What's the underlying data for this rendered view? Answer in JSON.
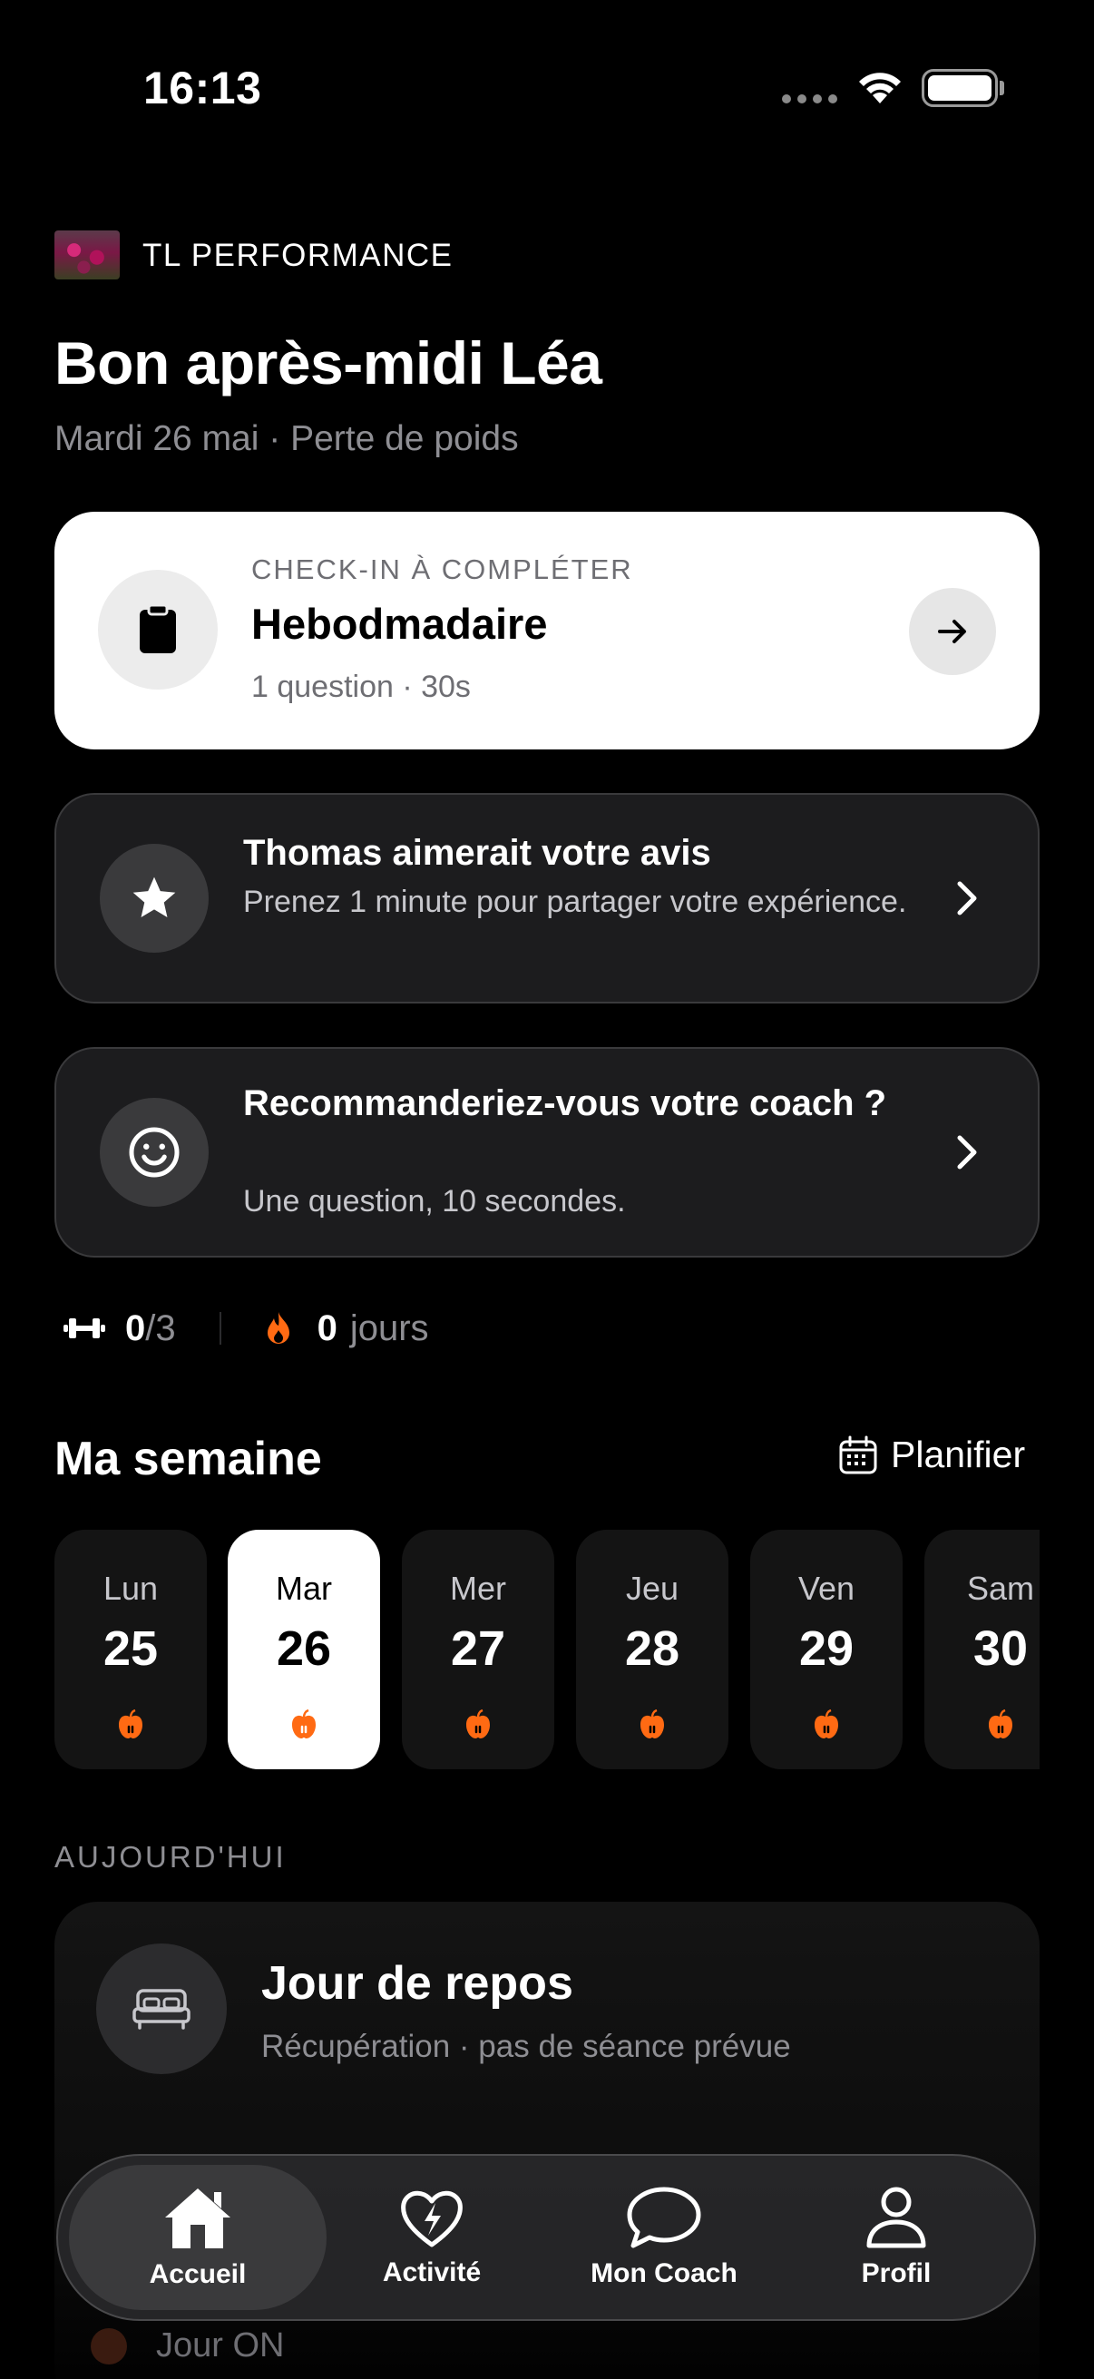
{
  "status_bar": {
    "time": "16:13"
  },
  "brand": {
    "name": "TL PERFORMANCE"
  },
  "header": {
    "greeting": "Bon après-midi Léa",
    "subline": "Mardi 26 mai · Perte de poids"
  },
  "checkin": {
    "overline": "CHECK-IN À COMPLÉTER",
    "title": "Hebodmadaire",
    "meta": "1 question · 30s"
  },
  "feedback_cards": [
    {
      "title": "Thomas aimerait votre avis",
      "description": "Prenez 1 minute pour partager votre expérience.",
      "icon": "star-icon"
    },
    {
      "title": "Recommanderiez-vous votre coach ?",
      "description": "Une question, 10 secondes.",
      "icon": "smile-icon"
    }
  ],
  "stats": {
    "workouts_done": "0",
    "workouts_total": "/3",
    "streak_value": "0",
    "streak_unit": "jours"
  },
  "week": {
    "title": "Ma semaine",
    "plan_label": "Planifier",
    "days": [
      {
        "name": "Lun",
        "num": "25",
        "active": false
      },
      {
        "name": "Mar",
        "num": "26",
        "active": true
      },
      {
        "name": "Mer",
        "num": "27",
        "active": false
      },
      {
        "name": "Jeu",
        "num": "28",
        "active": false
      },
      {
        "name": "Ven",
        "num": "29",
        "active": false
      },
      {
        "name": "Sam",
        "num": "30",
        "active": false
      }
    ]
  },
  "today": {
    "label": "AUJOURD'HUI",
    "title": "Jour de repos",
    "description": "Récupération · pas de séance prévue",
    "peek_label": "Jour ON"
  },
  "tabbar": {
    "tabs": [
      {
        "label": "Accueil",
        "icon": "home-icon",
        "active": true
      },
      {
        "label": "Activité",
        "icon": "heart-bolt-icon",
        "active": false
      },
      {
        "label": "Mon Coach",
        "icon": "chat-bubble-icon",
        "active": false
      },
      {
        "label": "Profil",
        "icon": "person-icon",
        "active": false
      }
    ]
  },
  "colors": {
    "accent_orange": "#ff6a13",
    "card_dark": "#1c1c1e",
    "muted_text": "#8e8e93"
  }
}
